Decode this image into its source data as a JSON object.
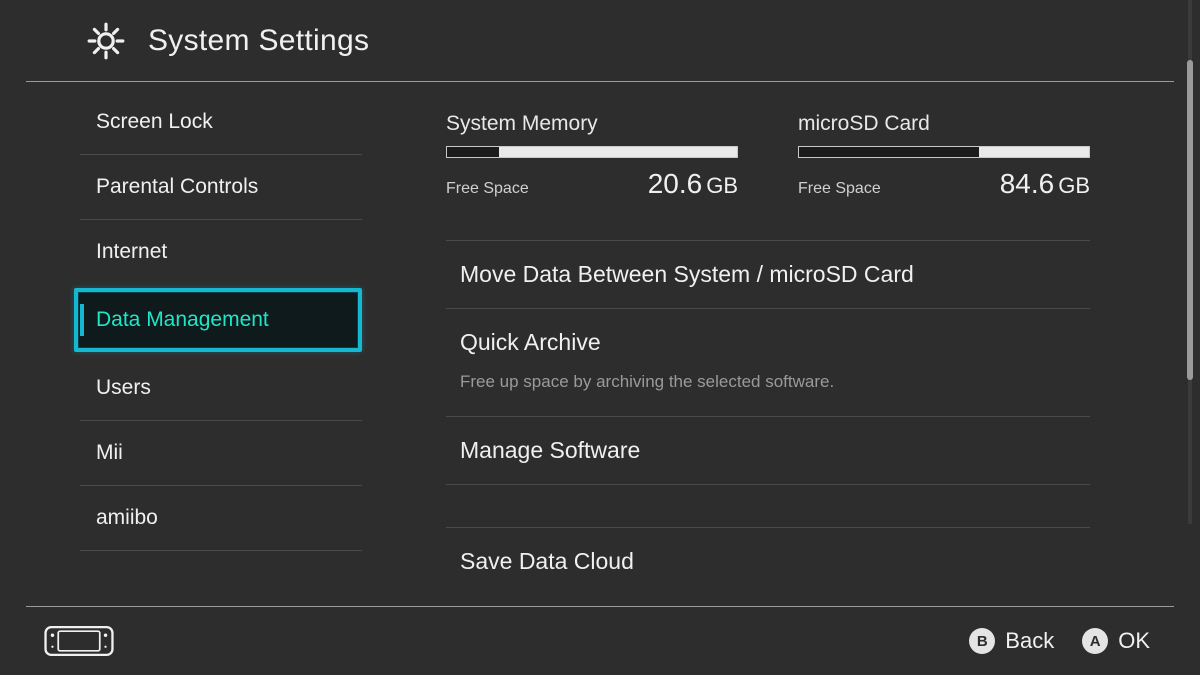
{
  "header": {
    "title": "System Settings"
  },
  "sidebar": {
    "items": [
      {
        "label": "Screen Lock",
        "selected": false
      },
      {
        "label": "Parental Controls",
        "selected": false
      },
      {
        "label": "Internet",
        "selected": false
      },
      {
        "label": "Data Management",
        "selected": true
      },
      {
        "label": "Users",
        "selected": false
      },
      {
        "label": "Mii",
        "selected": false
      },
      {
        "label": "amiibo",
        "selected": false
      }
    ]
  },
  "storage": {
    "system": {
      "title": "System Memory",
      "free_label": "Free Space",
      "free_value": "20.6",
      "unit": "GB",
      "fill_percent": 18
    },
    "sd": {
      "title": "microSD Card",
      "free_label": "Free Space",
      "free_value": "84.6",
      "unit": "GB",
      "fill_percent": 62
    }
  },
  "options": [
    {
      "label": "Move Data Between System / microSD Card"
    },
    {
      "label": "Quick Archive",
      "description": "Free up space by archiving the selected software."
    },
    {
      "label": "Manage Software"
    },
    {
      "label": "Save Data Cloud"
    }
  ],
  "footer": {
    "back": {
      "glyph": "B",
      "label": "Back"
    },
    "ok": {
      "glyph": "A",
      "label": "OK"
    }
  }
}
